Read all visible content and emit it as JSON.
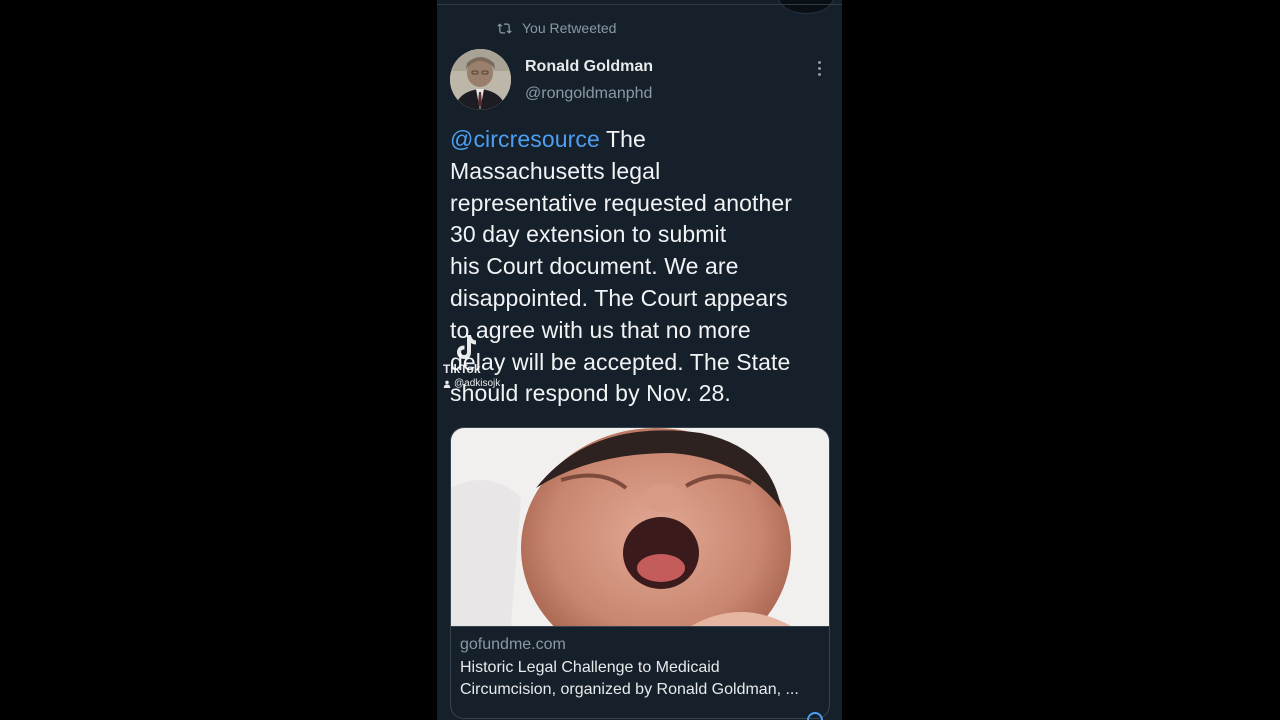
{
  "retweet": {
    "label": "You Retweeted",
    "icon": "retweet-icon"
  },
  "author": {
    "name": "Ronald Goldman",
    "handle": "@rongoldmanphd",
    "avatar": "avatar-photo"
  },
  "tweet": {
    "mention": "@circresource",
    "lines": [
      " The",
      "Massachusetts legal",
      "representative requested another",
      "30 day extension to submit",
      "his Court document. We are",
      "disappointed. The Court appears",
      "to agree with us that no more",
      "delay will be accepted. The State",
      "should respond by Nov. 28."
    ]
  },
  "watermark": {
    "brand": "TikTok",
    "user": "@adkisojk"
  },
  "card": {
    "domain": "gofundme.com",
    "title_line1": "Historic Legal Challenge to Medicaid",
    "title_line2": "Circumcision, organized by Ronald Goldman, ..."
  },
  "colors": {
    "background": "#15202b",
    "link": "#4d9ef0",
    "muted": "#8b98a5",
    "text": "#f1f3f4"
  }
}
